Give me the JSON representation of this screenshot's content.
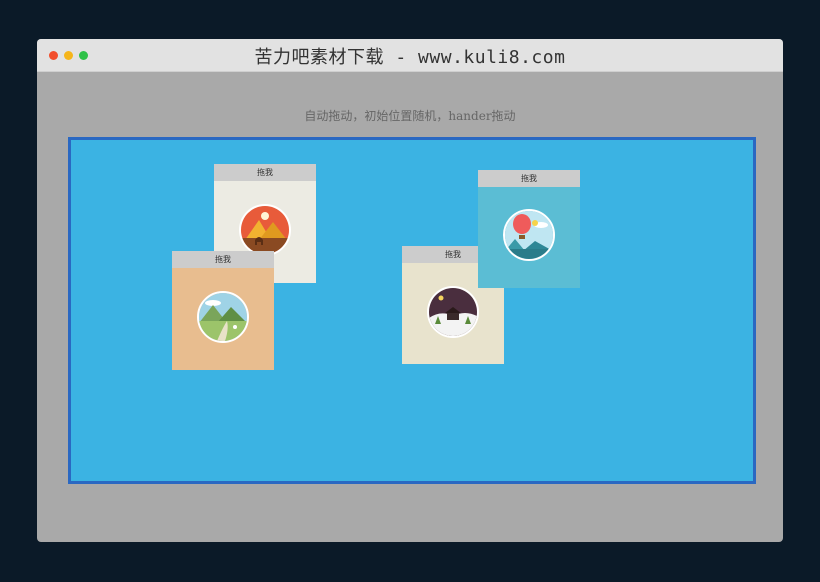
{
  "window": {
    "title": "苦力吧素材下载 - www.kuli8.com"
  },
  "page": {
    "caption": "自动拖动，初始位置随机，hander拖动"
  },
  "cards": [
    {
      "handle_label": "拖我",
      "image": "desert-camel-illustration",
      "bg_color": "#ecebe3"
    },
    {
      "handle_label": "拖我",
      "image": "mountain-meadow-illustration",
      "bg_color": "#e8bd8f"
    },
    {
      "handle_label": "拖我",
      "image": "winter-night-cabin-illustration",
      "bg_color": "#e8e3cd"
    },
    {
      "handle_label": "拖我",
      "image": "hot-air-balloon-illustration",
      "bg_color": "#5bbdd4"
    }
  ],
  "colors": {
    "stage_bg": "#3bb3e3",
    "stage_border": "#2a68c2",
    "handle_bg": "#cccccc"
  }
}
